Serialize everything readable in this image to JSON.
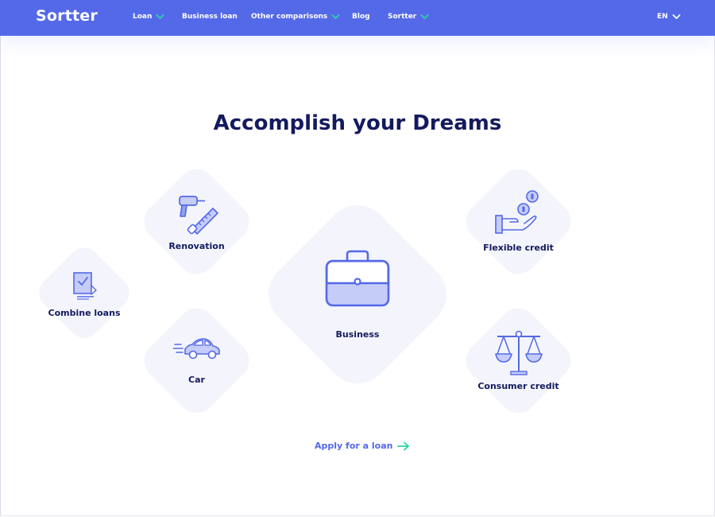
{
  "brand": {
    "logo": "Sortter"
  },
  "nav": {
    "items": [
      {
        "label": "Loan",
        "has_dropdown": true
      },
      {
        "label": "Business loan",
        "has_dropdown": false
      },
      {
        "label": "Other comparisons",
        "has_dropdown": true
      },
      {
        "label": "Blog",
        "has_dropdown": false
      },
      {
        "label": "Sortter",
        "has_dropdown": true
      }
    ],
    "language": "EN"
  },
  "main": {
    "heading": "Accomplish your Dreams",
    "tiles": [
      {
        "label": "Combine loans",
        "icon": "document-check-icon"
      },
      {
        "label": "Renovation",
        "icon": "drill-saw-icon"
      },
      {
        "label": "Car",
        "icon": "car-icon"
      },
      {
        "label": "Business",
        "icon": "briefcase-icon"
      },
      {
        "label": "Flexible credit",
        "icon": "hand-coins-icon"
      },
      {
        "label": "Consumer credit",
        "icon": "scales-icon"
      }
    ],
    "cta": {
      "label": "Apply for a loan",
      "icon": "arrow-right-icon"
    }
  },
  "colors": {
    "brand_blue": "#5469e8",
    "heading_navy": "#131a5e",
    "tile_bg": "#f4f5fc",
    "accent_teal": "#2ed3a8"
  }
}
